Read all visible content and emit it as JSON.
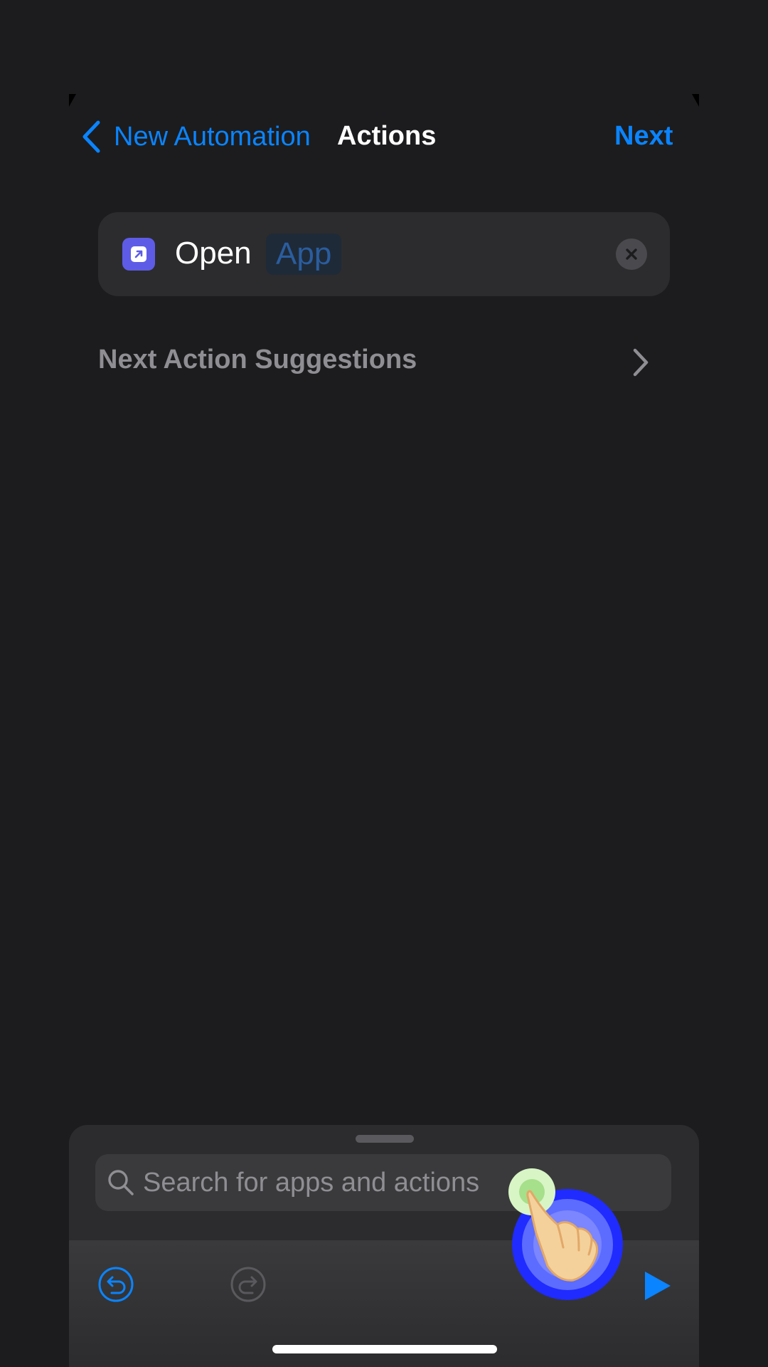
{
  "nav": {
    "back_label": "New Automation",
    "title": "Actions",
    "next_label": "Next"
  },
  "action": {
    "verb": "Open",
    "parameter": "App",
    "icon": "open-app-icon"
  },
  "suggestions": {
    "label": "Next Action Suggestions"
  },
  "search": {
    "placeholder": "Search for apps and actions"
  },
  "toolbar": {
    "undo_icon": "undo-icon",
    "redo_icon": "redo-icon",
    "play_icon": "play-icon"
  },
  "colors": {
    "accent": "#0a84ff",
    "background": "#1c1c1e",
    "card": "#2c2c2e",
    "app_icon": "#5e5ce6"
  }
}
